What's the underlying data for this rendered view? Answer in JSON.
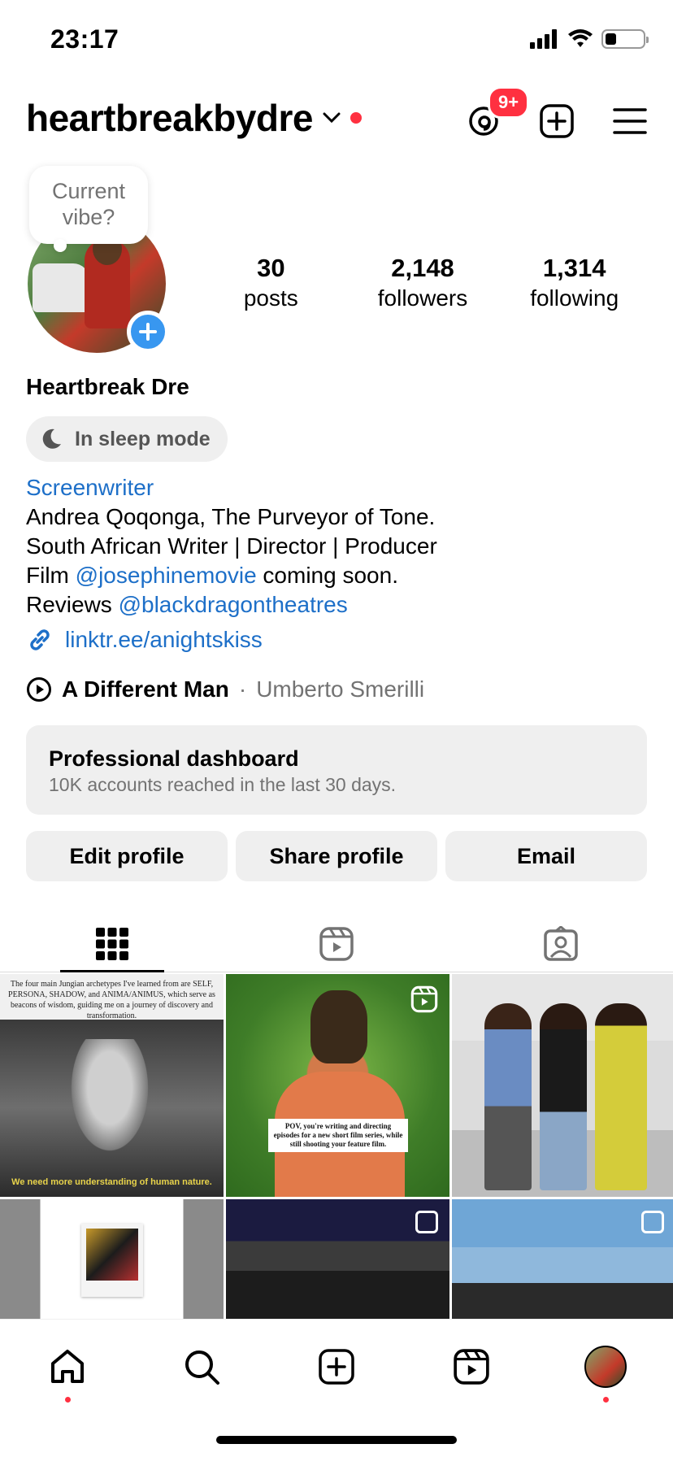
{
  "status_bar": {
    "time": "23:17"
  },
  "header": {
    "username": "heartbreakbydre",
    "threads_badge": "9+"
  },
  "profile": {
    "vibe_prompt": "Current vibe?",
    "stats": [
      {
        "value": "30",
        "label": "posts"
      },
      {
        "value": "2,148",
        "label": "followers"
      },
      {
        "value": "1,314",
        "label": "following"
      }
    ],
    "display_name": "Heartbreak Dre",
    "sleep_mode": "In sleep mode",
    "category": "Screenwriter",
    "bio_line1": "Andrea Qoqonga, The Purveyor of Tone.",
    "bio_line2": "South African Writer | Director | Producer",
    "bio_line3_prefix": "Film ",
    "bio_line3_mention": "@josephinemovie",
    "bio_line3_suffix": " coming soon.",
    "bio_line4_prefix": "Reviews ",
    "bio_line4_mention": "@blackdragontheatres",
    "link": "linktr.ee/anightskiss",
    "music": {
      "title": "A Different Man",
      "separator": " · ",
      "artist": "Umberto Smerilli"
    }
  },
  "dashboard": {
    "title": "Professional dashboard",
    "subtitle": "10K accounts reached in the last 30 days."
  },
  "buttons": {
    "edit": "Edit profile",
    "share": "Share profile",
    "email": "Email"
  },
  "grid_posts": {
    "post1_text": "The four main Jungian archetypes I've learned from are SELF, PERSONA, SHADOW, and ANIMA/ANIMUS, which serve as beacons of wisdom, guiding me on a journey of discovery and transformation.",
    "post1_caption": "We need more understanding of human nature.",
    "post2_text": "POV, you're writing and directing episodes for a new short film series, while still shooting your feature film."
  },
  "colors": {
    "accent": "#1d6fc8",
    "badge": "#ff3040",
    "story_add": "#3897f0"
  }
}
